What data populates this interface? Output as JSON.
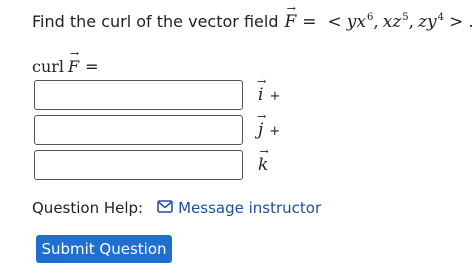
{
  "question": {
    "prompt": "Find the curl of the vector field",
    "field_var": "F",
    "equals": "=",
    "open": "<",
    "comp1_base": "yx",
    "comp1_exp": "6",
    "sep1": ",",
    "comp2_base": "xz",
    "comp2_exp": "5",
    "sep2": ",",
    "comp3_base": "zy",
    "comp3_exp": "4",
    "close": ">",
    "period": "."
  },
  "answer": {
    "label_word": "curl",
    "label_var": "F",
    "label_eq": "=",
    "components": [
      {
        "unit": "i",
        "suffix": "+",
        "value": ""
      },
      {
        "unit": "j",
        "suffix": "+",
        "value": ""
      },
      {
        "unit": "k",
        "suffix": "",
        "value": ""
      }
    ]
  },
  "help": {
    "label": "Question Help:",
    "icon": "mail-icon",
    "link_text": "Message instructor"
  },
  "submit": {
    "label": "Submit Question",
    "color": "#1f6fd2"
  }
}
